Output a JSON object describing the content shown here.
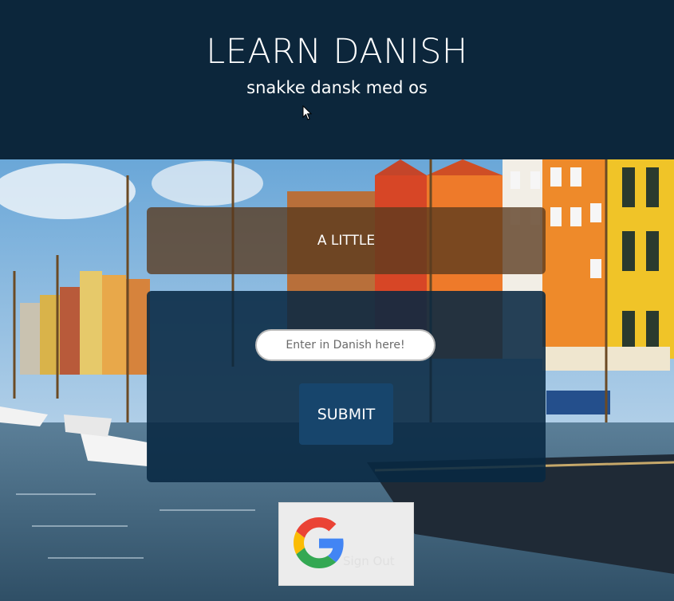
{
  "header": {
    "title": "LEARN DANISH",
    "subtitle": "snakke dansk med os"
  },
  "word_card": {
    "text": "A LITTLE"
  },
  "answer_form": {
    "placeholder": "Enter in Danish here!",
    "value": "",
    "submit_label": "SUBMIT"
  },
  "auth": {
    "signout_label": "Sign Out",
    "provider_icon": "google-logo"
  },
  "colors": {
    "header_bg": "#0c263b",
    "panel_bg": "#082842",
    "submit_bg": "#17456c",
    "word_card_bg": "#5a3a1e"
  }
}
